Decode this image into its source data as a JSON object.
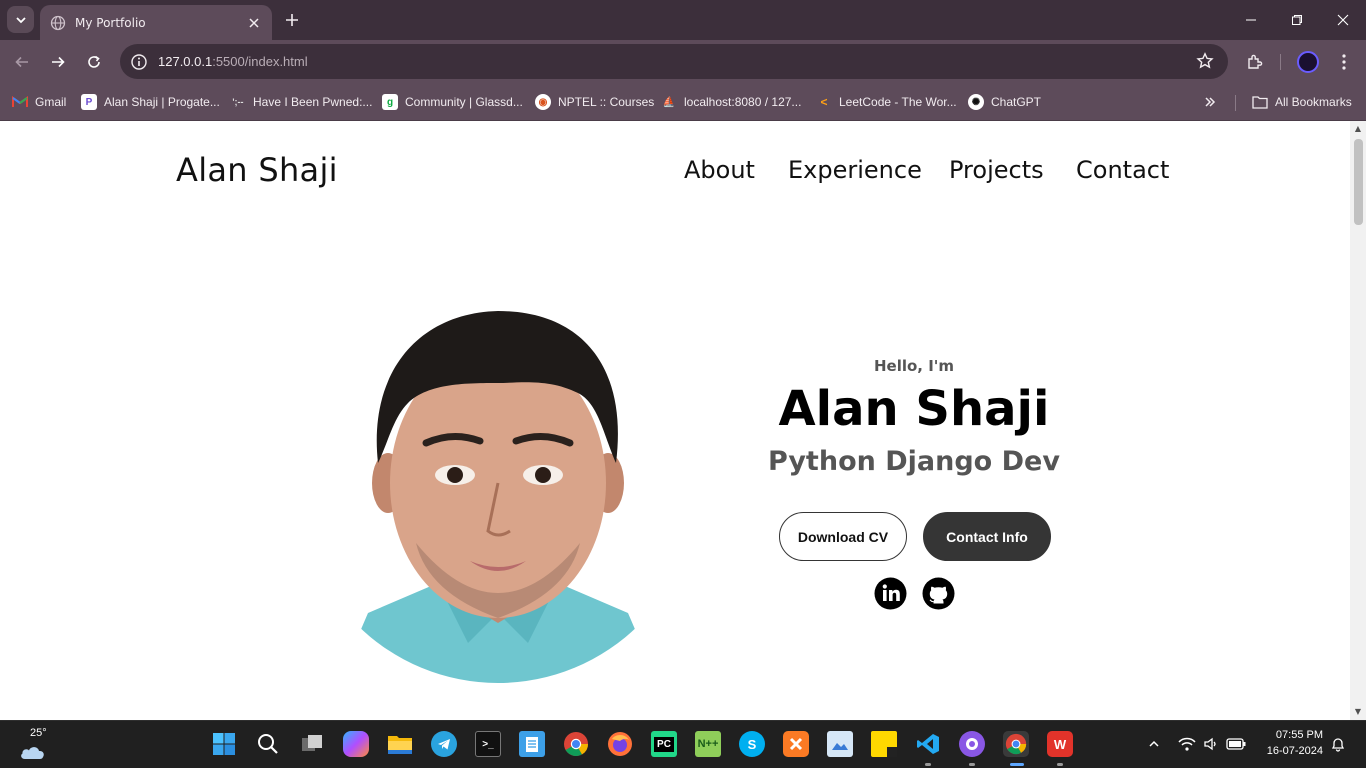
{
  "browser": {
    "tab_title": "My Portfolio",
    "url_host": "127.0.0.1",
    "url_rest": ":5500/index.html",
    "bookmarks": [
      {
        "label": "Gmail",
        "icon": "gmail-icon",
        "color": "#ea4335"
      },
      {
        "label": "Alan Shaji | Progate...",
        "icon": "progate-icon",
        "color": "#6b4bd1"
      },
      {
        "label": "Have I Been Pwned:...",
        "icon": "hibp-icon",
        "color": "#333333"
      },
      {
        "label": "Community | Glassd...",
        "icon": "glassdoor-icon",
        "color": "#0caa41"
      },
      {
        "label": "NPTEL :: Courses",
        "icon": "nptel-icon",
        "color": "#d9531e"
      },
      {
        "label": "localhost:8080 / 127...",
        "icon": "phpmyadmin-icon",
        "color": "#f0a000"
      },
      {
        "label": "LeetCode - The Wor...",
        "icon": "leetcode-icon",
        "color": "#ffa116"
      },
      {
        "label": "ChatGPT",
        "icon": "chatgpt-icon",
        "color": "#ffffff"
      }
    ],
    "all_bookmarks": "All Bookmarks"
  },
  "page": {
    "logo": "Alan Shaji",
    "nav": [
      "About",
      "Experience",
      "Projects",
      "Contact"
    ],
    "hello": "Hello, I'm",
    "name": "Alan Shaji",
    "role": "Python Django Dev",
    "download_cv": "Download CV",
    "contact_info": "Contact Info",
    "social": [
      "linkedin-icon",
      "github-icon"
    ]
  },
  "taskbar": {
    "temperature": "25°",
    "time": "07:55 PM",
    "date": "16-07-2024",
    "apps": [
      "windows-start-icon",
      "search-icon",
      "task-view-icon",
      "copilot-icon",
      "file-explorer-icon",
      "telegram-icon",
      "terminal-icon",
      "notepad-icon",
      "chrome-icon",
      "firefox-icon",
      "pycharm-icon",
      "notepadpp-icon",
      "skype-icon",
      "xampp-icon",
      "photos-icon",
      "sticky-notes-icon",
      "vscode-icon",
      "github-desktop-icon",
      "chrome-profile-icon",
      "wps-office-icon"
    ]
  }
}
